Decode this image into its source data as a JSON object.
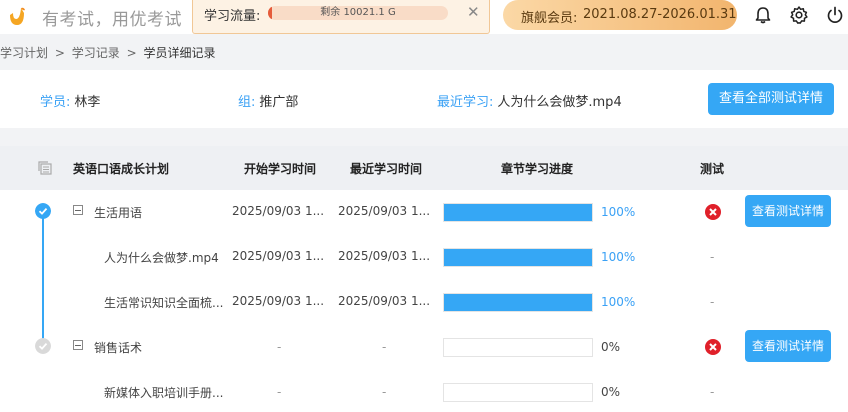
{
  "app": {
    "slogan": "有考试，用优考试"
  },
  "traffic": {
    "label": "学习流量:",
    "remaining_text": "剩余 10021.1 G",
    "used_fraction": 0.02
  },
  "vip": {
    "label": "旗舰会员:",
    "period": "2021.08.27-2026.01.31"
  },
  "breadcrumb": {
    "items": [
      "学习计划",
      "学习记录",
      "学员详细记录"
    ],
    "separator": ">"
  },
  "info": {
    "student_key": "学员:",
    "student_value": "林李",
    "group_key": "组:",
    "group_value": "推广部",
    "recent_key": "最近学习:",
    "recent_value": "人为什么会做梦.mp4",
    "all_tests_button": "查看全部测试详情"
  },
  "table": {
    "headers": {
      "plan": "英语口语成长计划",
      "start": "开始学习时间",
      "recent": "最近学习时间",
      "progress": "章节学习进度",
      "test": "测试"
    },
    "rows": [
      {
        "name": "生活用语",
        "start": "2025/09/03 1...",
        "recent": "2025/09/03 1...",
        "progress": 100,
        "progress_label": "100%",
        "test": "fail",
        "button": "查看测试详情"
      },
      {
        "name": "人为什么会做梦.mp4",
        "start": "2025/09/03 1...",
        "recent": "2025/09/03 1...",
        "progress": 100,
        "progress_label": "100%",
        "test": "-"
      },
      {
        "name": "生活常识知识全面梳...",
        "start": "2025/09/03 1...",
        "recent": "2025/09/03 1...",
        "progress": 100,
        "progress_label": "100%",
        "test": "-"
      },
      {
        "name": "销售话术",
        "start": "-",
        "recent": "-",
        "progress": 0,
        "progress_label": "0%",
        "test": "fail",
        "button": "查看测试详情"
      },
      {
        "name": "新媒体入职培训手册...",
        "start": "-",
        "recent": "-",
        "progress": 0,
        "progress_label": "0%",
        "test": "-"
      }
    ]
  },
  "colors": {
    "accent": "#35a7f5",
    "fail": "#e0202a",
    "vip_gradient_start": "#fbd8a6",
    "vip_gradient_end": "#f2b56e"
  }
}
